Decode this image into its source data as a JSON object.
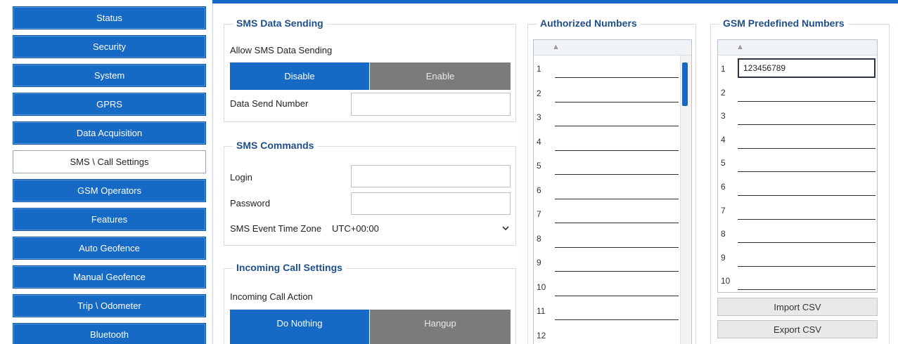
{
  "nav": {
    "items": [
      {
        "label": "Status",
        "active": false
      },
      {
        "label": "Security",
        "active": false
      },
      {
        "label": "System",
        "active": false
      },
      {
        "label": "GPRS",
        "active": false
      },
      {
        "label": "Data Acquisition",
        "active": false
      },
      {
        "label": "SMS \\ Call Settings",
        "active": true
      },
      {
        "label": "GSM Operators",
        "active": false
      },
      {
        "label": "Features",
        "active": false
      },
      {
        "label": "Auto Geofence",
        "active": false
      },
      {
        "label": "Manual Geofence",
        "active": false
      },
      {
        "label": "Trip \\ Odometer",
        "active": false
      },
      {
        "label": "Bluetooth",
        "active": false
      }
    ]
  },
  "sms_data_sending": {
    "title": "SMS Data Sending",
    "allow_label": "Allow SMS Data Sending",
    "disable_label": "Disable",
    "enable_label": "Enable",
    "selected": "Disable",
    "send_number_label": "Data Send Number",
    "send_number_value": ""
  },
  "sms_commands": {
    "title": "SMS Commands",
    "login_label": "Login",
    "login_value": "",
    "password_label": "Password",
    "password_value": "",
    "timezone_label": "SMS Event Time Zone",
    "timezone_value": "UTC+00:00"
  },
  "incoming_call": {
    "title": "Incoming Call Settings",
    "action_label": "Incoming Call Action",
    "do_nothing_label": "Do Nothing",
    "hangup_label": "Hangup",
    "selected": "Do Nothing"
  },
  "authorized_numbers": {
    "title": "Authorized Numbers",
    "rows": [
      "1",
      "2",
      "3",
      "4",
      "5",
      "6",
      "7",
      "8",
      "9",
      "10",
      "11",
      "12"
    ],
    "values": [
      "",
      "",
      "",
      "",
      "",
      "",
      "",
      "",
      "",
      "",
      "",
      ""
    ]
  },
  "gsm_predefined_numbers": {
    "title": "GSM Predefined Numbers",
    "rows": [
      "1",
      "2",
      "3",
      "4",
      "5",
      "6",
      "7",
      "8",
      "9",
      "10"
    ],
    "values": [
      "123456789",
      "",
      "",
      "",
      "",
      "",
      "",
      "",
      "",
      ""
    ],
    "import_label": "Import CSV",
    "export_label": "Export CSV"
  },
  "colors": {
    "accent": "#1669c5",
    "inactive_segment": "#7b7b7b",
    "group_title": "#1f4f8a"
  }
}
